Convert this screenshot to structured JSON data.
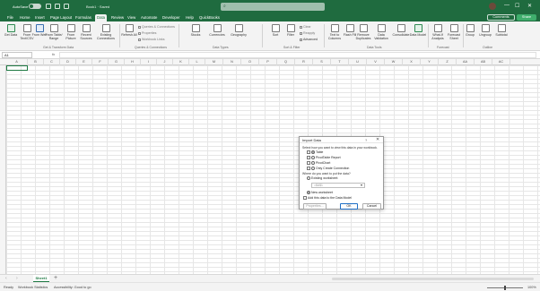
{
  "titlebar": {
    "autosave_label": "AutoSave",
    "autosave_state": "Off",
    "doc_title": "Book1 · Saved",
    "search_icon": "search-icon",
    "window_buttons": [
      "—",
      "☐",
      "✕"
    ]
  },
  "tabs": [
    "File",
    "Home",
    "Insert",
    "Page Layout",
    "Formulas",
    "Data",
    "Review",
    "View",
    "Automate",
    "Developer",
    "Help",
    "QuickBooks"
  ],
  "active_tab": "Data",
  "actions": {
    "comments": "Comments",
    "share": "Share"
  },
  "ribbon": {
    "get_transform": {
      "buttons": [
        "Get Data",
        "From Text/CSV",
        "From Web",
        "From Table/ Range",
        "From Picture",
        "Recent Sources",
        "Existing Connections"
      ],
      "label": "Get & Transform Data"
    },
    "queries": {
      "refresh": "Refresh All",
      "items": [
        "Queries & Connections",
        "Properties",
        "Workbook Links"
      ],
      "label": "Queries & Connections"
    },
    "data_types": {
      "buttons": [
        "Stocks",
        "Currencies",
        "Geography"
      ],
      "label": "Data Types"
    },
    "sort_filter": {
      "buttons": [
        "Sort",
        "Filter"
      ],
      "items": [
        "Clear",
        "Reapply",
        "Advanced"
      ],
      "label": "Sort & Filter"
    },
    "data_tools": {
      "buttons": [
        "Text to Columns",
        "Flash Fill",
        "Remove Duplicates",
        "Data Validation",
        "Consolidate",
        "Data Model"
      ],
      "label": "Data Tools"
    },
    "forecast": {
      "buttons": [
        "What-If Analysis",
        "Forecast Sheet"
      ],
      "label": "Forecast"
    },
    "outline": {
      "buttons": [
        "Group",
        "Ungroup",
        "Subtotal"
      ],
      "label": "Outline"
    }
  },
  "formula_bar": {
    "name_box": "A1",
    "fx": "fx",
    "value": ""
  },
  "columns": [
    "A",
    "B",
    "C",
    "D",
    "E",
    "F",
    "G",
    "H",
    "I",
    "J",
    "K",
    "L",
    "M",
    "N",
    "O",
    "P",
    "Q",
    "R",
    "S",
    "T",
    "U",
    "V",
    "W",
    "X",
    "Y",
    "Z",
    "AA",
    "AB",
    "AC"
  ],
  "sheets": {
    "active": "Sheet1",
    "add": "+"
  },
  "status": {
    "ready": "Ready",
    "statistics": "Workbook Statistics",
    "accessibility": "Accessibility: Good to go",
    "zoom": "100%"
  },
  "dialog": {
    "title": "Import Data",
    "help": "?",
    "close": "✕",
    "prompt_view": "Select how you want to view this data in your workbook.",
    "view_options": [
      {
        "label": "Table",
        "selected": true,
        "icon": "table-icon"
      },
      {
        "label": "PivotTable Report",
        "selected": false,
        "icon": "pivottable-icon"
      },
      {
        "label": "PivotChart",
        "selected": false,
        "icon": "pivotchart-icon"
      },
      {
        "label": "Only Create Connection",
        "selected": false,
        "icon": "connection-icon"
      }
    ],
    "prompt_place": "Where do you want to put the data?",
    "existing": "Existing worksheet:",
    "range_value": "=$A$1",
    "new_sheet": "New worksheet",
    "add_model": "Add this data to the Data Model",
    "properties": "Properties...",
    "ok": "OK",
    "cancel": "Cancel"
  }
}
